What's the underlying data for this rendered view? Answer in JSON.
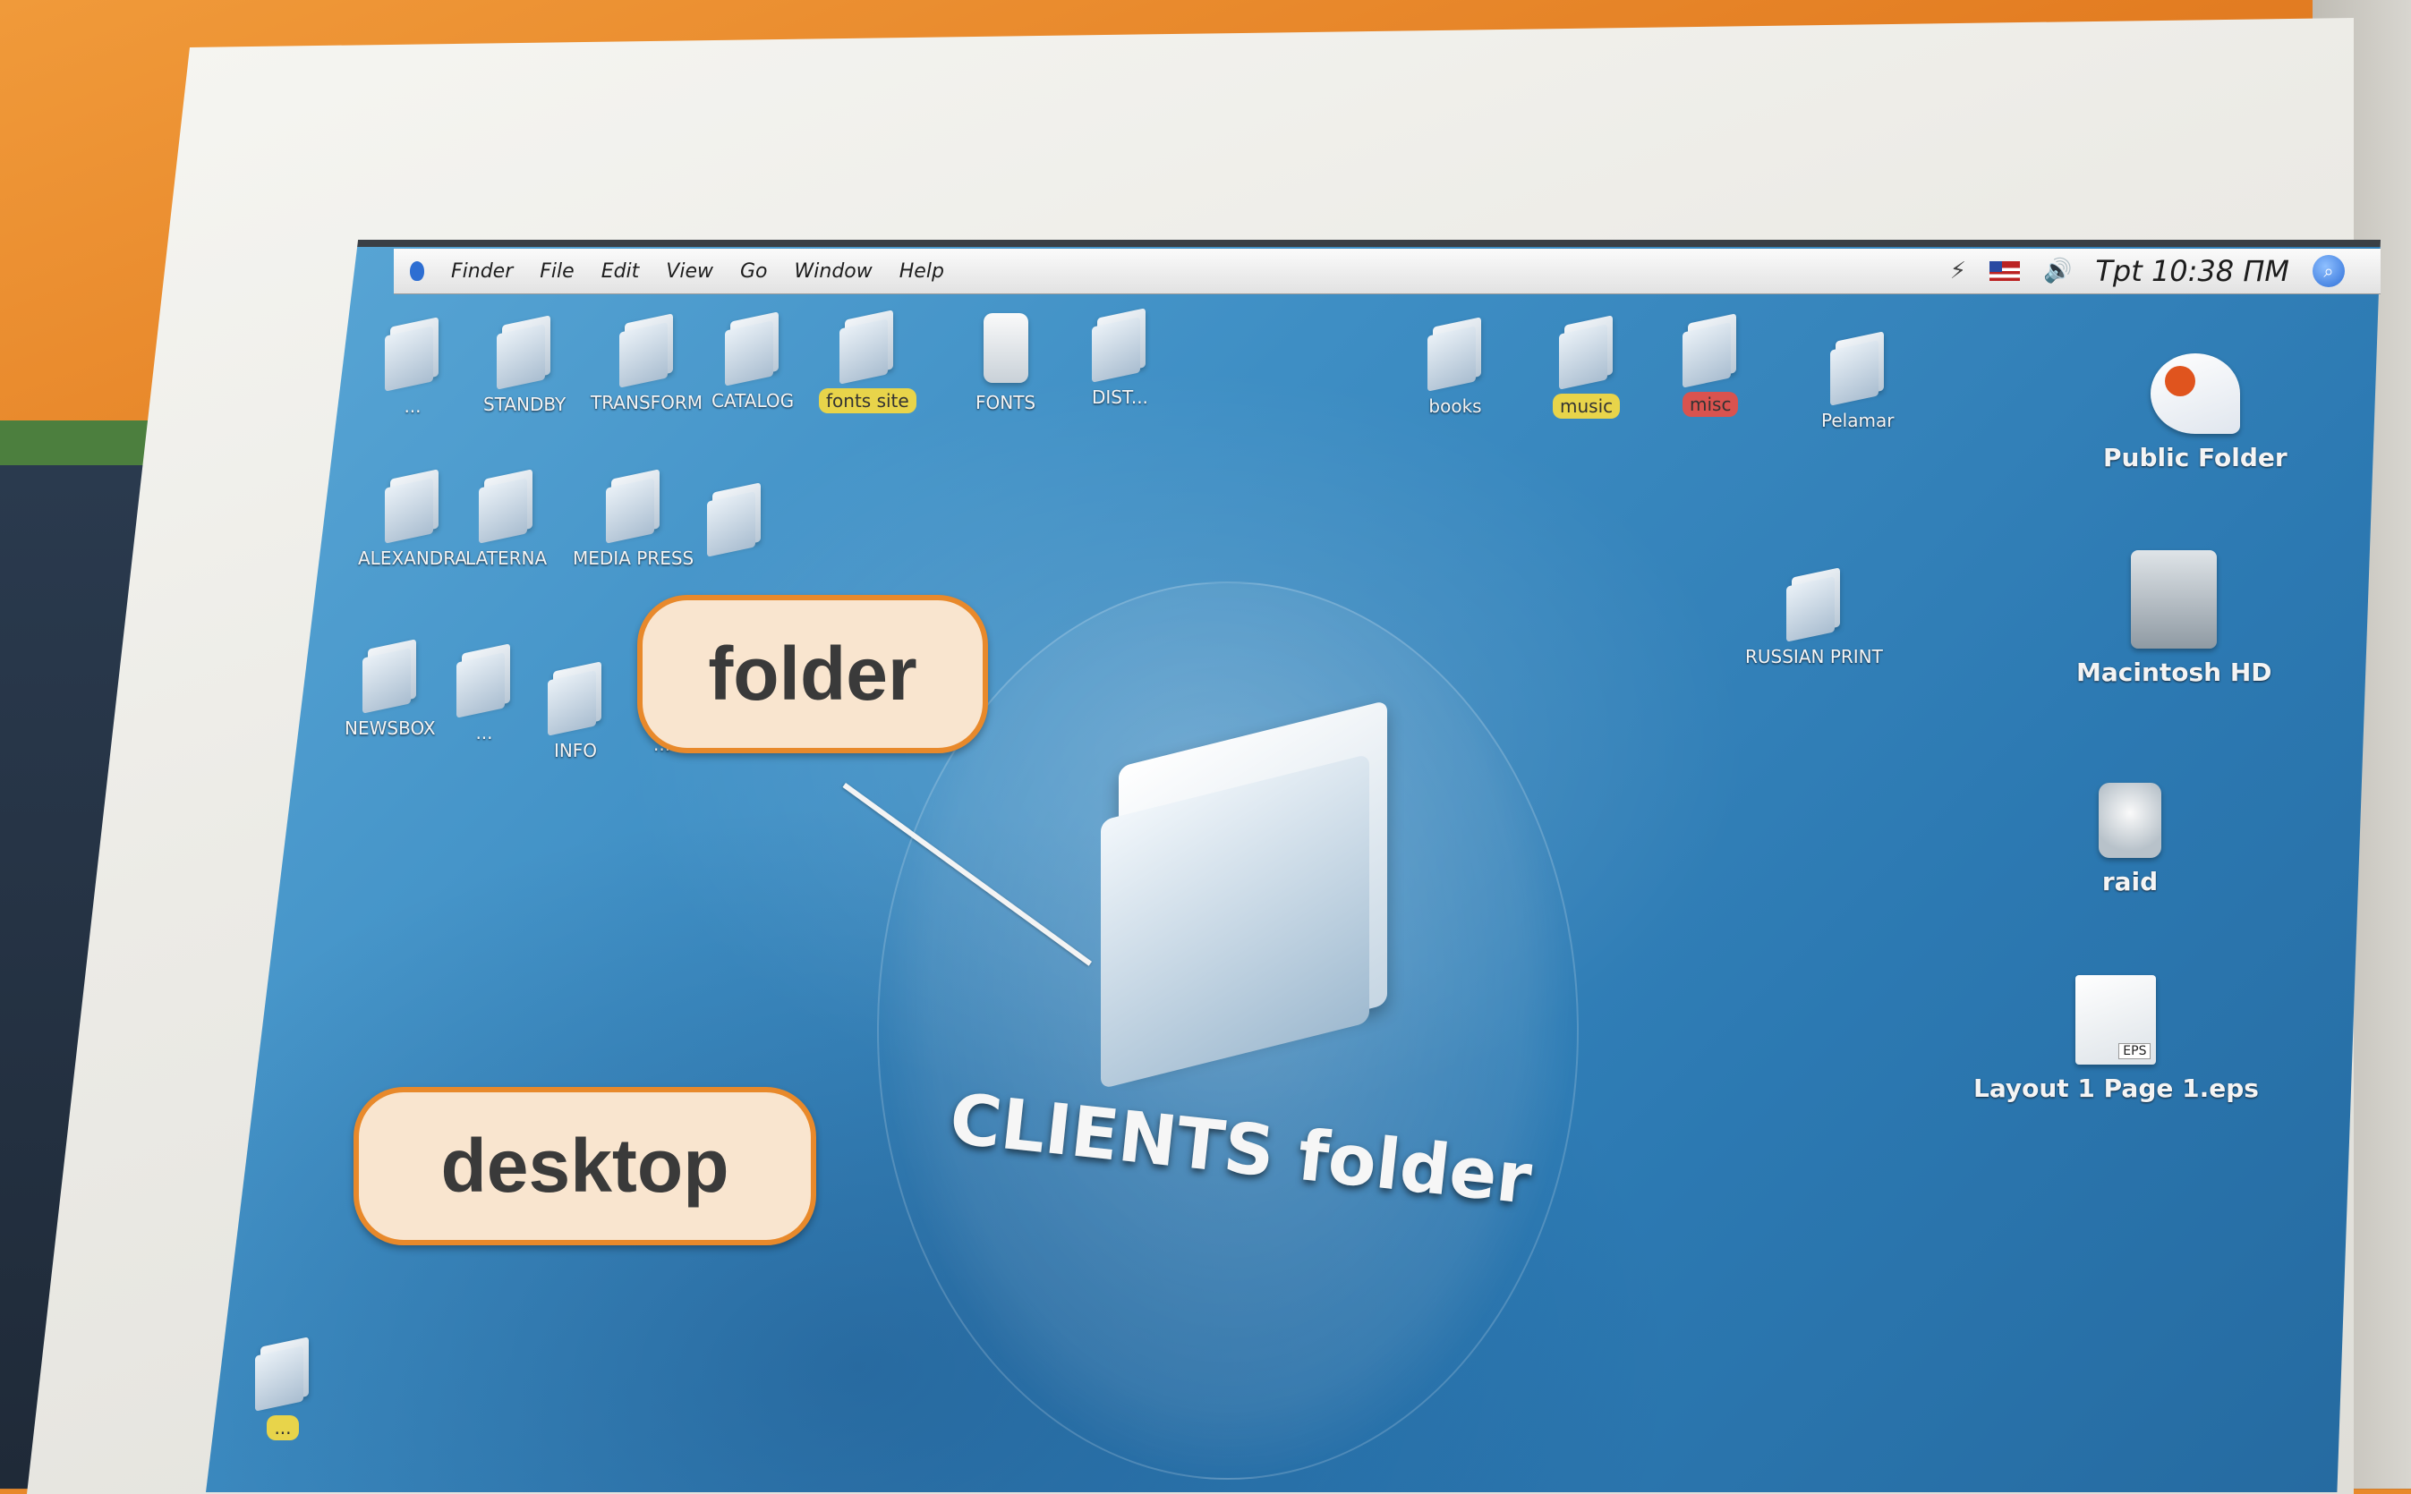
{
  "menubar": {
    "items": [
      "Finder",
      "File",
      "Edit",
      "View",
      "Go",
      "Window",
      "Help"
    ],
    "clock": "Tpt 10:38 ΠM"
  },
  "callouts": {
    "folder": "folder",
    "desktop": "desktop"
  },
  "highlight": {
    "label": "CLIENTS folder"
  },
  "desktop_icons": {
    "row1": [
      "...",
      "STANDBY",
      "TRANSFORM",
      "CATALOG",
      "fonts site",
      "FONTS",
      "DIST..."
    ],
    "row1_right": [
      "books",
      "music",
      "misc",
      "Pelamar"
    ],
    "row2": [
      "ALEXANDRA",
      "LATERNA",
      "MEDIA PRESS"
    ],
    "row3": [
      "NEWSBOX",
      "...",
      "INFO",
      "..."
    ],
    "right_column": [
      "Public Folder",
      "Macintosh HD",
      "raid",
      "Layout 1 Page 1.eps"
    ],
    "russian": "RUSSIAN PRINT",
    "bottom": "..."
  },
  "colors": {
    "accent_orange": "#e8892b",
    "callout_fill": "#f9e5cf",
    "desktop_blue": "#3e8ec4"
  }
}
